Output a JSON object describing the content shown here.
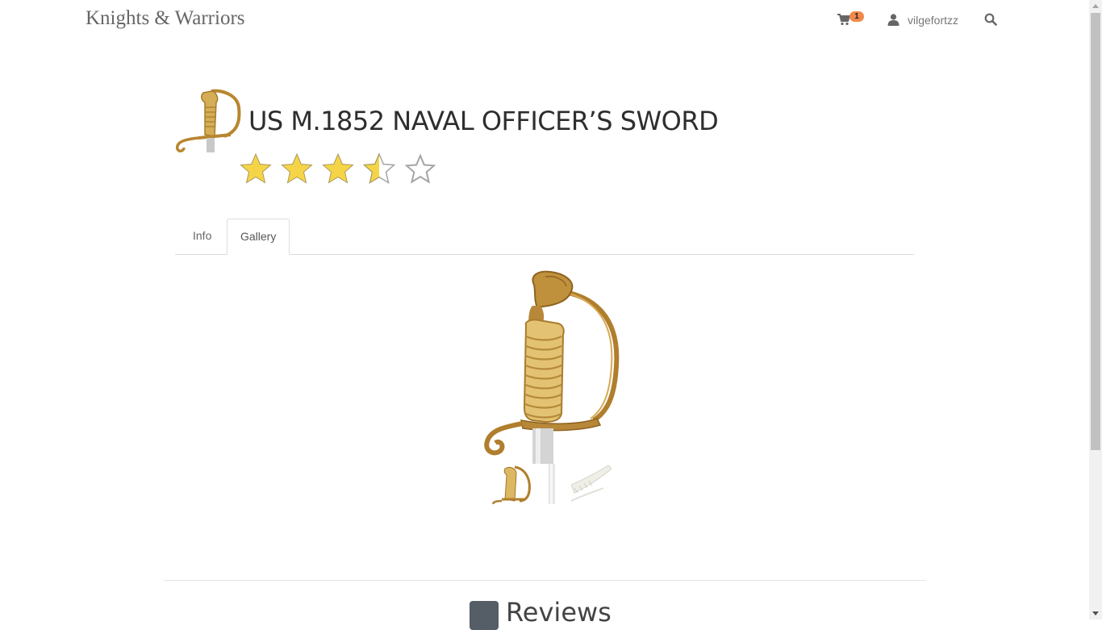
{
  "navbar": {
    "brand": "Knights & Warriors",
    "cart_count": "1",
    "username": "vilgefortzz"
  },
  "product": {
    "title": "US M.1852 NAVAL OFFICER’S SWORD",
    "rating": 3.5,
    "rating_max": 5
  },
  "tabs": [
    {
      "label": "Info",
      "active": false
    },
    {
      "label": "Gallery",
      "active": true
    }
  ],
  "gallery": {
    "thumbnail_count": 3
  },
  "reviews": {
    "title": "Reviews"
  },
  "icons": {
    "cart": "shopping-cart-icon",
    "user": "user-icon",
    "search": "search-icon",
    "reviews": "comments-icon"
  },
  "colors": {
    "star_fill": "#f5d547",
    "badge": "#f0894c"
  }
}
